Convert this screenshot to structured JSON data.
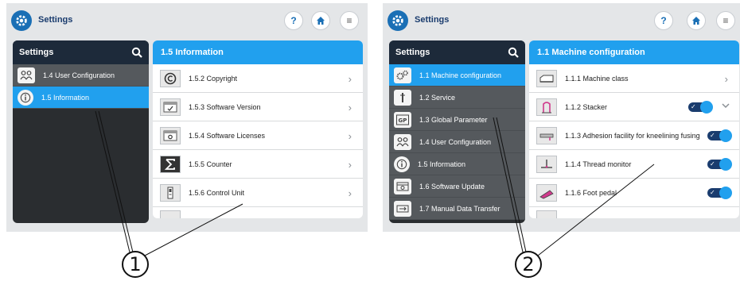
{
  "left_screen": {
    "title": "Settings",
    "buttons": {
      "help": "?",
      "menu": "≡"
    },
    "sidebar": {
      "title": "Settings",
      "items": [
        {
          "label": "1.4  User Configuration",
          "icon": "users-icon",
          "active": false
        },
        {
          "label": "1.5  Information",
          "icon": "info-icon",
          "active": true
        }
      ]
    },
    "content": {
      "title": "1.5 Information",
      "rows": [
        {
          "label": "1.5.2  Copyright",
          "icon": "copyright-icon"
        },
        {
          "label": "1.5.3  Software Version",
          "icon": "software-version-icon"
        },
        {
          "label": "1.5.4  Software Licenses",
          "icon": "license-icon"
        },
        {
          "label": "1.5.5  Counter",
          "icon": "sigma-icon"
        },
        {
          "label": "1.5.6  Control Unit",
          "icon": "control-unit-icon"
        }
      ]
    },
    "callout": "1"
  },
  "right_screen": {
    "title": "Settings",
    "buttons": {
      "help": "?",
      "menu": "≡"
    },
    "sidebar": {
      "title": "Settings",
      "items": [
        {
          "label": "1.1  Machine configuration",
          "icon": "gears-icon",
          "active": true
        },
        {
          "label": "1.2  Service",
          "icon": "service-icon",
          "active": false
        },
        {
          "label": "1.3  Global Parameter",
          "icon": "gp-icon",
          "icon_text": "GP",
          "active": false
        },
        {
          "label": "1.4  User Configuration",
          "icon": "users-icon",
          "active": false
        },
        {
          "label": "1.5  Information",
          "icon": "info-icon",
          "active": false
        },
        {
          "label": "1.6  Software Update",
          "icon": "update-icon",
          "active": false
        },
        {
          "label": "1.7  Manual Data Transfer",
          "icon": "transfer-icon",
          "active": false
        }
      ]
    },
    "content": {
      "title": "1.1 Machine configuration",
      "rows": [
        {
          "label": "1.1.1  Machine class",
          "icon": "machine-class-icon",
          "control": "chevron"
        },
        {
          "label": "1.1.2  Stacker",
          "icon": "stacker-icon",
          "control": "toggle-expand"
        },
        {
          "label": "1.1.3  Adhesion facility for kneelining fusing",
          "icon": "adhesion-icon",
          "control": "toggle"
        },
        {
          "label": "1.1.4  Thread monitor",
          "icon": "thread-monitor-icon",
          "control": "toggle"
        },
        {
          "label": "1.1.6  Foot pedal",
          "icon": "foot-pedal-icon",
          "control": "toggle"
        }
      ]
    },
    "callout": "2"
  },
  "colors": {
    "accent": "#21a0ee",
    "navy": "#1a3c6e",
    "sidebar": "#55595d"
  }
}
